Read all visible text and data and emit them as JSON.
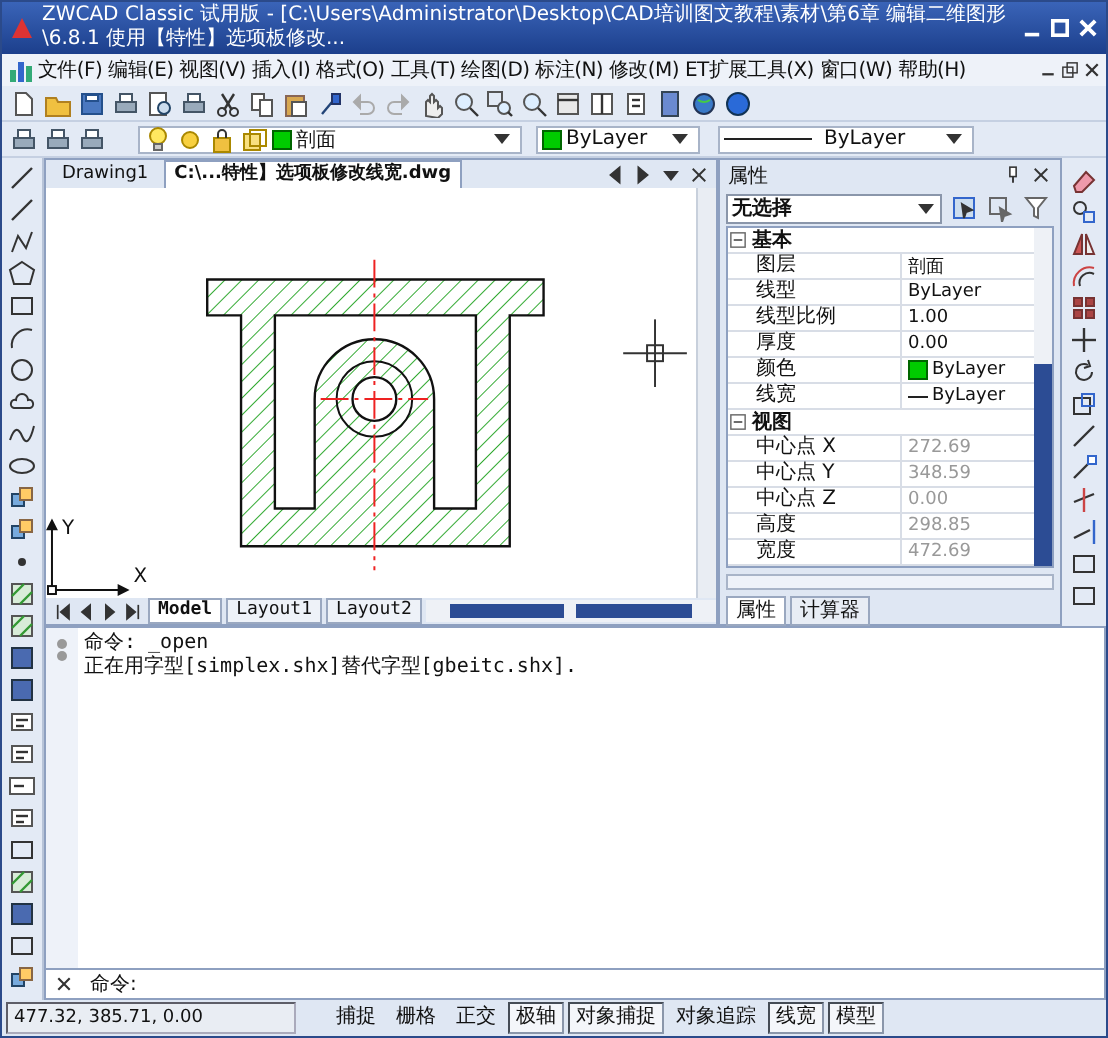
{
  "window": {
    "title": "ZWCAD Classic 试用版 - [C:\\Users\\Administrator\\Desktop\\CAD培训图文教程\\素材\\第6章 编辑二维图形\\6.8.1   使用【特性】选项板修改..."
  },
  "menu": [
    "文件(F)",
    "编辑(E)",
    "视图(V)",
    "插入(I)",
    "格式(O)",
    "工具(T)",
    "绘图(D)",
    "标注(N)",
    "修改(M)",
    "ET扩展工具(X)",
    "窗口(W)",
    "帮助(H)"
  ],
  "layer_bar": {
    "layer": "剖面",
    "color_name": "ByLayer",
    "linetype": "ByLayer"
  },
  "document_tabs": [
    {
      "label": "Drawing1",
      "selected": false
    },
    {
      "label": "C:\\...特性】选项板修改线宽.dwg",
      "selected": true
    }
  ],
  "ucs": {
    "x_label": "X",
    "y_label": "Y"
  },
  "layout_tabs": [
    {
      "label": "Model",
      "selected": true
    },
    {
      "label": "Layout1",
      "selected": false
    },
    {
      "label": "Layout2",
      "selected": false
    }
  ],
  "properties": {
    "title": "属性",
    "selection": "无选择",
    "groups": [
      {
        "name": "基本",
        "expanded": true,
        "rows": [
          {
            "name": "图层",
            "value": "剖面",
            "kind": "text",
            "disabled": false
          },
          {
            "name": "线型",
            "value": "ByLayer",
            "kind": "text",
            "disabled": false
          },
          {
            "name": "线型比例",
            "value": "1.00",
            "kind": "text",
            "disabled": false
          },
          {
            "name": "厚度",
            "value": "0.00",
            "kind": "text",
            "disabled": false
          },
          {
            "name": "颜色",
            "value": "ByLayer",
            "kind": "color",
            "disabled": false
          },
          {
            "name": "线宽",
            "value": "ByLayer",
            "kind": "linetype",
            "disabled": false
          }
        ]
      },
      {
        "name": "视图",
        "expanded": true,
        "rows": [
          {
            "name": "中心点 X",
            "value": "272.69",
            "kind": "text",
            "disabled": true
          },
          {
            "name": "中心点 Y",
            "value": "348.59",
            "kind": "text",
            "disabled": true
          },
          {
            "name": "中心点 Z",
            "value": "0.00",
            "kind": "text",
            "disabled": true
          },
          {
            "name": "高度",
            "value": "298.85",
            "kind": "text",
            "disabled": true
          },
          {
            "name": "宽度",
            "value": "472.69",
            "kind": "text",
            "disabled": true
          }
        ]
      }
    ],
    "tabs": [
      {
        "label": "属性",
        "selected": true
      },
      {
        "label": "计算器",
        "selected": false
      }
    ]
  },
  "command": {
    "history": [
      "命令: _open",
      "正在用字型[simplex.shx]替代字型[gbeitc.shx]."
    ],
    "prompt": "命令:"
  },
  "status_bar": {
    "coordinates": "477.32,  385.71,  0.00",
    "toggles": [
      {
        "label": "捕捉",
        "on": false
      },
      {
        "label": "栅格",
        "on": false
      },
      {
        "label": "正交",
        "on": false
      },
      {
        "label": "极轴",
        "on": true
      },
      {
        "label": "对象捕捉",
        "on": true
      },
      {
        "label": "对象追踪",
        "on": false
      },
      {
        "label": "线宽",
        "on": true
      },
      {
        "label": "模型",
        "on": true
      }
    ]
  }
}
